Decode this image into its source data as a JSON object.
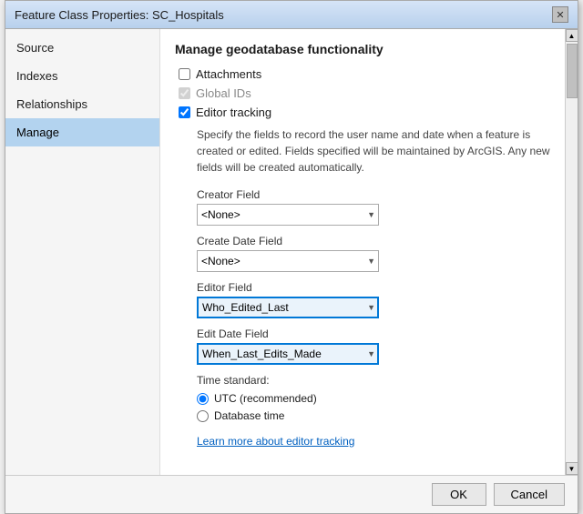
{
  "dialog": {
    "title": "Feature Class Properties: SC_Hospitals",
    "close_label": "✕"
  },
  "sidebar": {
    "items": [
      {
        "id": "source",
        "label": "Source",
        "active": false
      },
      {
        "id": "indexes",
        "label": "Indexes",
        "active": false
      },
      {
        "id": "relationships",
        "label": "Relationships",
        "active": false
      },
      {
        "id": "manage",
        "label": "Manage",
        "active": true
      }
    ]
  },
  "content": {
    "title": "Manage geodatabase functionality",
    "checkboxes": {
      "attachments": {
        "label": "Attachments",
        "checked": false,
        "disabled": false
      },
      "global_ids": {
        "label": "Global IDs",
        "checked": true,
        "disabled": true
      },
      "editor_tracking": {
        "label": "Editor tracking",
        "checked": true,
        "disabled": false
      }
    },
    "description": "Specify the fields to record the user name and date when a feature is created or edited. Fields specified will be maintained by ArcGIS. Any new fields will be created automatically.",
    "fields": [
      {
        "id": "creator_field",
        "label": "Creator Field",
        "value": "<None>",
        "highlighted": false
      },
      {
        "id": "create_date_field",
        "label": "Create Date Field",
        "value": "<None>",
        "highlighted": false
      },
      {
        "id": "editor_field",
        "label": "Editor Field",
        "value": "Who_Edited_Last",
        "highlighted": true
      },
      {
        "id": "edit_date_field",
        "label": "Edit Date Field",
        "value": "When_Last_Edits_Made",
        "highlighted": true
      }
    ],
    "time_standard": {
      "label": "Time standard:",
      "options": [
        {
          "id": "utc",
          "label": "UTC (recommended)",
          "selected": true
        },
        {
          "id": "database_time",
          "label": "Database time",
          "selected": false
        }
      ]
    },
    "learn_more": "Learn more about editor tracking"
  },
  "footer": {
    "ok_label": "OK",
    "cancel_label": "Cancel"
  }
}
